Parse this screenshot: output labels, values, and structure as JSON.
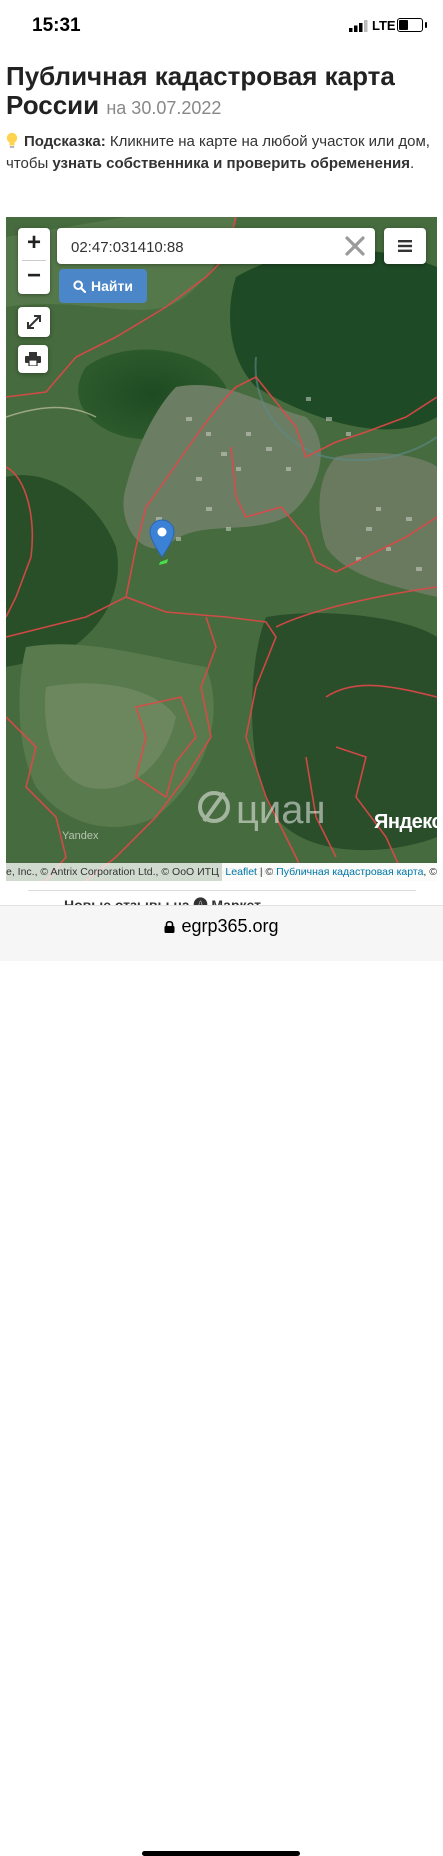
{
  "status_bar": {
    "time": "15:31",
    "network": "LTE",
    "signal_bars": 3,
    "battery_level": 0.35
  },
  "header": {
    "title_line1": "Публичная кадастровая карта",
    "title_line2": "России",
    "date": "на 30.07.2022"
  },
  "hint": {
    "label": "Подсказка:",
    "text1": " Кликните на карте на любой участок или дом, чтобы ",
    "bold": "узнать собственника и проверить обременения",
    "text2": "."
  },
  "map": {
    "zoom_in": "+",
    "zoom_out": "−",
    "search_value": "02:47:031410:88",
    "find_label": "Найти",
    "yandex_logo": "Яндекс",
    "yandex_small": "Yandex",
    "watermark": "циан",
    "attribution_left": "e, Inc., © Antrix Corporation Ltd., © ОоО ИТЦ «СКАНЭКС», Условия использования",
    "attribution_leaflet": "Leaflet",
    "attribution_sep": " | © ",
    "attribution_pkk": "Публичная кадастровая карта",
    "attribution_end": ", ©"
  },
  "reviews": {
    "label": "Новые отзывы на 🅐 Маркет"
  },
  "browser": {
    "url": "egrp365.org"
  },
  "colors": {
    "accent": "#4a86c8",
    "parcel_border": "#e04848",
    "pin": "#3b82d6"
  }
}
